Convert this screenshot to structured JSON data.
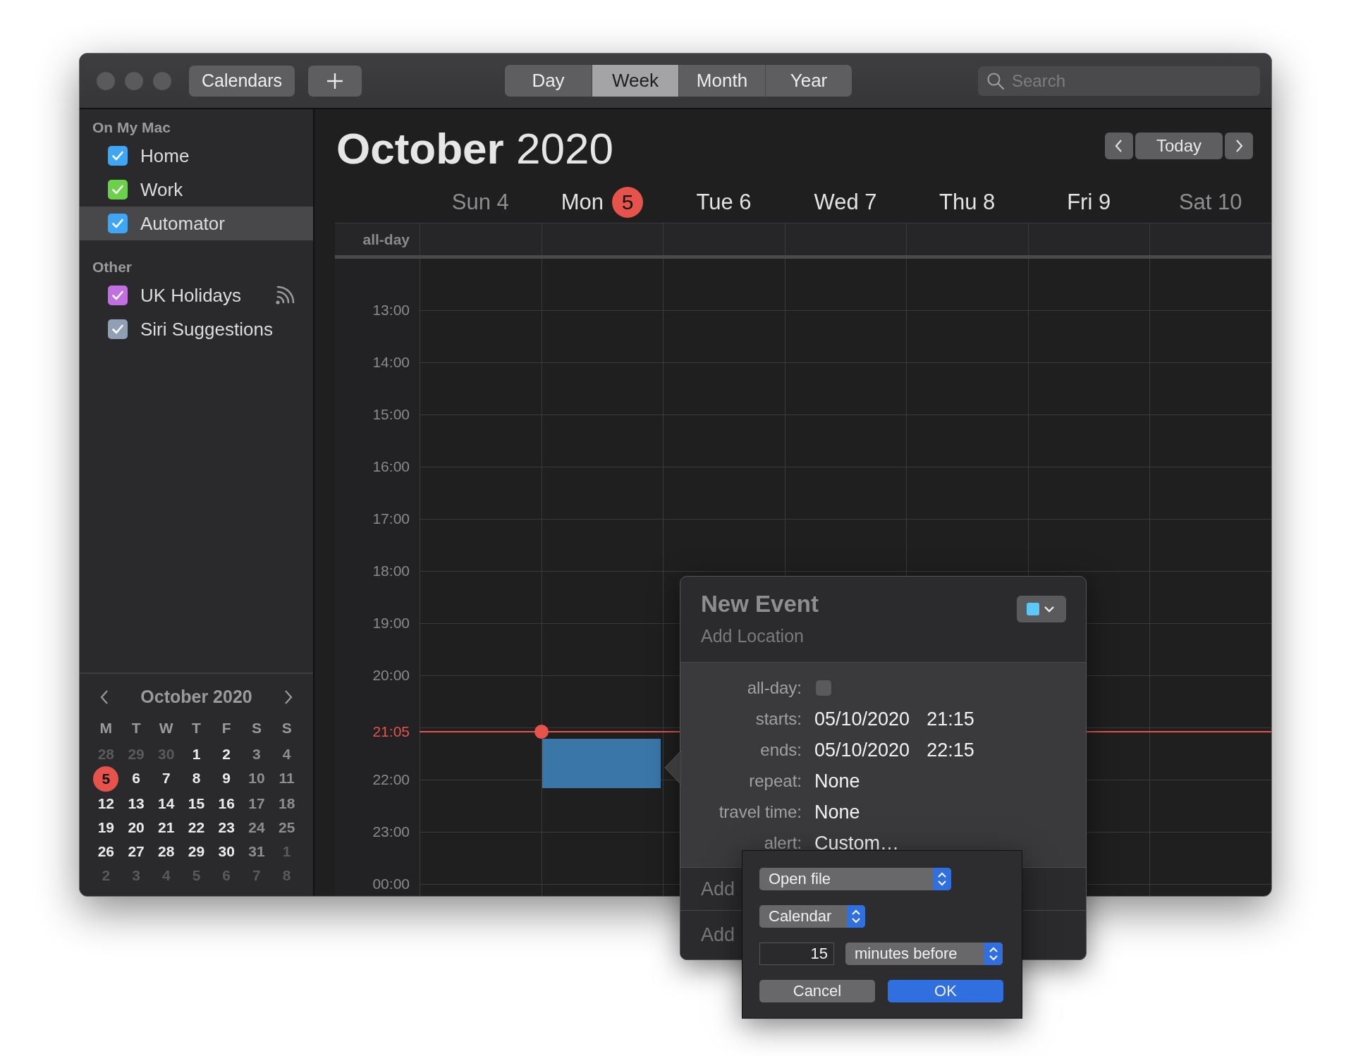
{
  "toolbar": {
    "calendars_button": "Calendars",
    "views": [
      {
        "label": "Day",
        "selected": false
      },
      {
        "label": "Week",
        "selected": true
      },
      {
        "label": "Month",
        "selected": false
      },
      {
        "label": "Year",
        "selected": false
      }
    ],
    "search": {
      "placeholder": "Search"
    }
  },
  "sidebar": {
    "groups": [
      {
        "title": "On My Mac",
        "items": [
          {
            "label": "Home",
            "checked": true,
            "color": "#3ea6f5",
            "selected": false,
            "subscribed": false
          },
          {
            "label": "Work",
            "checked": true,
            "color": "#6bd14a",
            "selected": false,
            "subscribed": false
          },
          {
            "label": "Automator",
            "checked": true,
            "color": "#3ea6f5",
            "selected": true,
            "subscribed": false
          }
        ]
      },
      {
        "title": "Other",
        "items": [
          {
            "label": "UK Holidays",
            "checked": true,
            "color": "#c26fe0",
            "selected": false,
            "subscribed": true
          },
          {
            "label": "Siri Suggestions",
            "checked": true,
            "color": "#8fa0b5",
            "selected": false,
            "subscribed": false
          }
        ]
      }
    ]
  },
  "mini_calendar": {
    "title": "October 2020",
    "weekdays": [
      "M",
      "T",
      "W",
      "T",
      "F",
      "S",
      "S"
    ],
    "days": [
      {
        "d": "28",
        "kind": "other",
        "today": false
      },
      {
        "d": "29",
        "kind": "other",
        "today": false
      },
      {
        "d": "30",
        "kind": "other",
        "today": false
      },
      {
        "d": "1",
        "kind": "weekday",
        "today": false
      },
      {
        "d": "2",
        "kind": "weekday",
        "today": false
      },
      {
        "d": "3",
        "kind": "weekend",
        "today": false
      },
      {
        "d": "4",
        "kind": "weekend",
        "today": false
      },
      {
        "d": "5",
        "kind": "weekday",
        "today": true
      },
      {
        "d": "6",
        "kind": "weekday",
        "today": false
      },
      {
        "d": "7",
        "kind": "weekday",
        "today": false
      },
      {
        "d": "8",
        "kind": "weekday",
        "today": false
      },
      {
        "d": "9",
        "kind": "weekday",
        "today": false
      },
      {
        "d": "10",
        "kind": "weekend",
        "today": false
      },
      {
        "d": "11",
        "kind": "weekend",
        "today": false
      },
      {
        "d": "12",
        "kind": "weekday",
        "today": false
      },
      {
        "d": "13",
        "kind": "weekday",
        "today": false
      },
      {
        "d": "14",
        "kind": "weekday",
        "today": false
      },
      {
        "d": "15",
        "kind": "weekday",
        "today": false
      },
      {
        "d": "16",
        "kind": "weekday",
        "today": false
      },
      {
        "d": "17",
        "kind": "weekend",
        "today": false
      },
      {
        "d": "18",
        "kind": "weekend",
        "today": false
      },
      {
        "d": "19",
        "kind": "weekday",
        "today": false
      },
      {
        "d": "20",
        "kind": "weekday",
        "today": false
      },
      {
        "d": "21",
        "kind": "weekday",
        "today": false
      },
      {
        "d": "22",
        "kind": "weekday",
        "today": false
      },
      {
        "d": "23",
        "kind": "weekday",
        "today": false
      },
      {
        "d": "24",
        "kind": "weekend",
        "today": false
      },
      {
        "d": "25",
        "kind": "weekend",
        "today": false
      },
      {
        "d": "26",
        "kind": "weekday",
        "today": false
      },
      {
        "d": "27",
        "kind": "weekday",
        "today": false
      },
      {
        "d": "28",
        "kind": "weekday",
        "today": false
      },
      {
        "d": "29",
        "kind": "weekday",
        "today": false
      },
      {
        "d": "30",
        "kind": "weekday",
        "today": false
      },
      {
        "d": "31",
        "kind": "weekend",
        "today": false
      },
      {
        "d": "1",
        "kind": "other",
        "today": false
      },
      {
        "d": "2",
        "kind": "other",
        "today": false
      },
      {
        "d": "3",
        "kind": "other",
        "today": false
      },
      {
        "d": "4",
        "kind": "other",
        "today": false
      },
      {
        "d": "5",
        "kind": "other",
        "today": false
      },
      {
        "d": "6",
        "kind": "other",
        "today": false
      },
      {
        "d": "7",
        "kind": "other",
        "today": false
      },
      {
        "d": "8",
        "kind": "other",
        "today": false
      }
    ]
  },
  "header": {
    "title": "**October** 2020",
    "today_button": "Today"
  },
  "days": [
    {
      "name": "Sun",
      "date": "4",
      "weekend": true,
      "today": false
    },
    {
      "name": "Mon",
      "date": "5",
      "weekend": false,
      "today": true
    },
    {
      "name": "Tue",
      "date": "6",
      "weekend": false,
      "today": false
    },
    {
      "name": "Wed",
      "date": "7",
      "weekend": false,
      "today": false
    },
    {
      "name": "Thu",
      "date": "8",
      "weekend": false,
      "today": false
    },
    {
      "name": "Fri",
      "date": "9",
      "weekend": false,
      "today": false
    },
    {
      "name": "Sat",
      "date": "10",
      "weekend": true,
      "today": false
    }
  ],
  "allday_label": "all-day",
  "hours": [
    {
      "label": "13:00",
      "kind": "hour"
    },
    {
      "label": "14:00",
      "kind": "hour"
    },
    {
      "label": "15:00",
      "kind": "hour"
    },
    {
      "label": "16:00",
      "kind": "hour"
    },
    {
      "label": "17:00",
      "kind": "hour"
    },
    {
      "label": "18:00",
      "kind": "hour"
    },
    {
      "label": "19:00",
      "kind": "hour"
    },
    {
      "label": "20:00",
      "kind": "hour"
    },
    {
      "label": "21:05",
      "kind": "now"
    },
    {
      "label": "22:00",
      "kind": "hour"
    },
    {
      "label": "23:00",
      "kind": "hour"
    },
    {
      "label": "00:00",
      "kind": "hour"
    }
  ],
  "new_event": {
    "title": "New Event",
    "location_placeholder": "Add Location",
    "fields": [
      {
        "label": "all-day:",
        "kind": "checkbox",
        "checked": false
      },
      {
        "label": "starts:",
        "kind": "datetime",
        "date": "05/10/2020",
        "time": "21:15"
      },
      {
        "label": "ends:",
        "kind": "datetime",
        "date": "05/10/2020",
        "time": "22:15"
      },
      {
        "label": "repeat:",
        "kind": "text",
        "value": "None"
      },
      {
        "label": "travel time:",
        "kind": "text",
        "value": "None"
      },
      {
        "label": "alert:",
        "kind": "text",
        "value": "Custom…"
      }
    ],
    "extra_rows": [
      "Add",
      "Add"
    ]
  },
  "alert_editor": {
    "action": "Open file",
    "file": "Calendar",
    "amount": "15",
    "unit": "minutes before",
    "buttons": [
      {
        "label": "Cancel",
        "kind": "cancel"
      },
      {
        "label": "OK",
        "kind": "default"
      }
    ]
  }
}
